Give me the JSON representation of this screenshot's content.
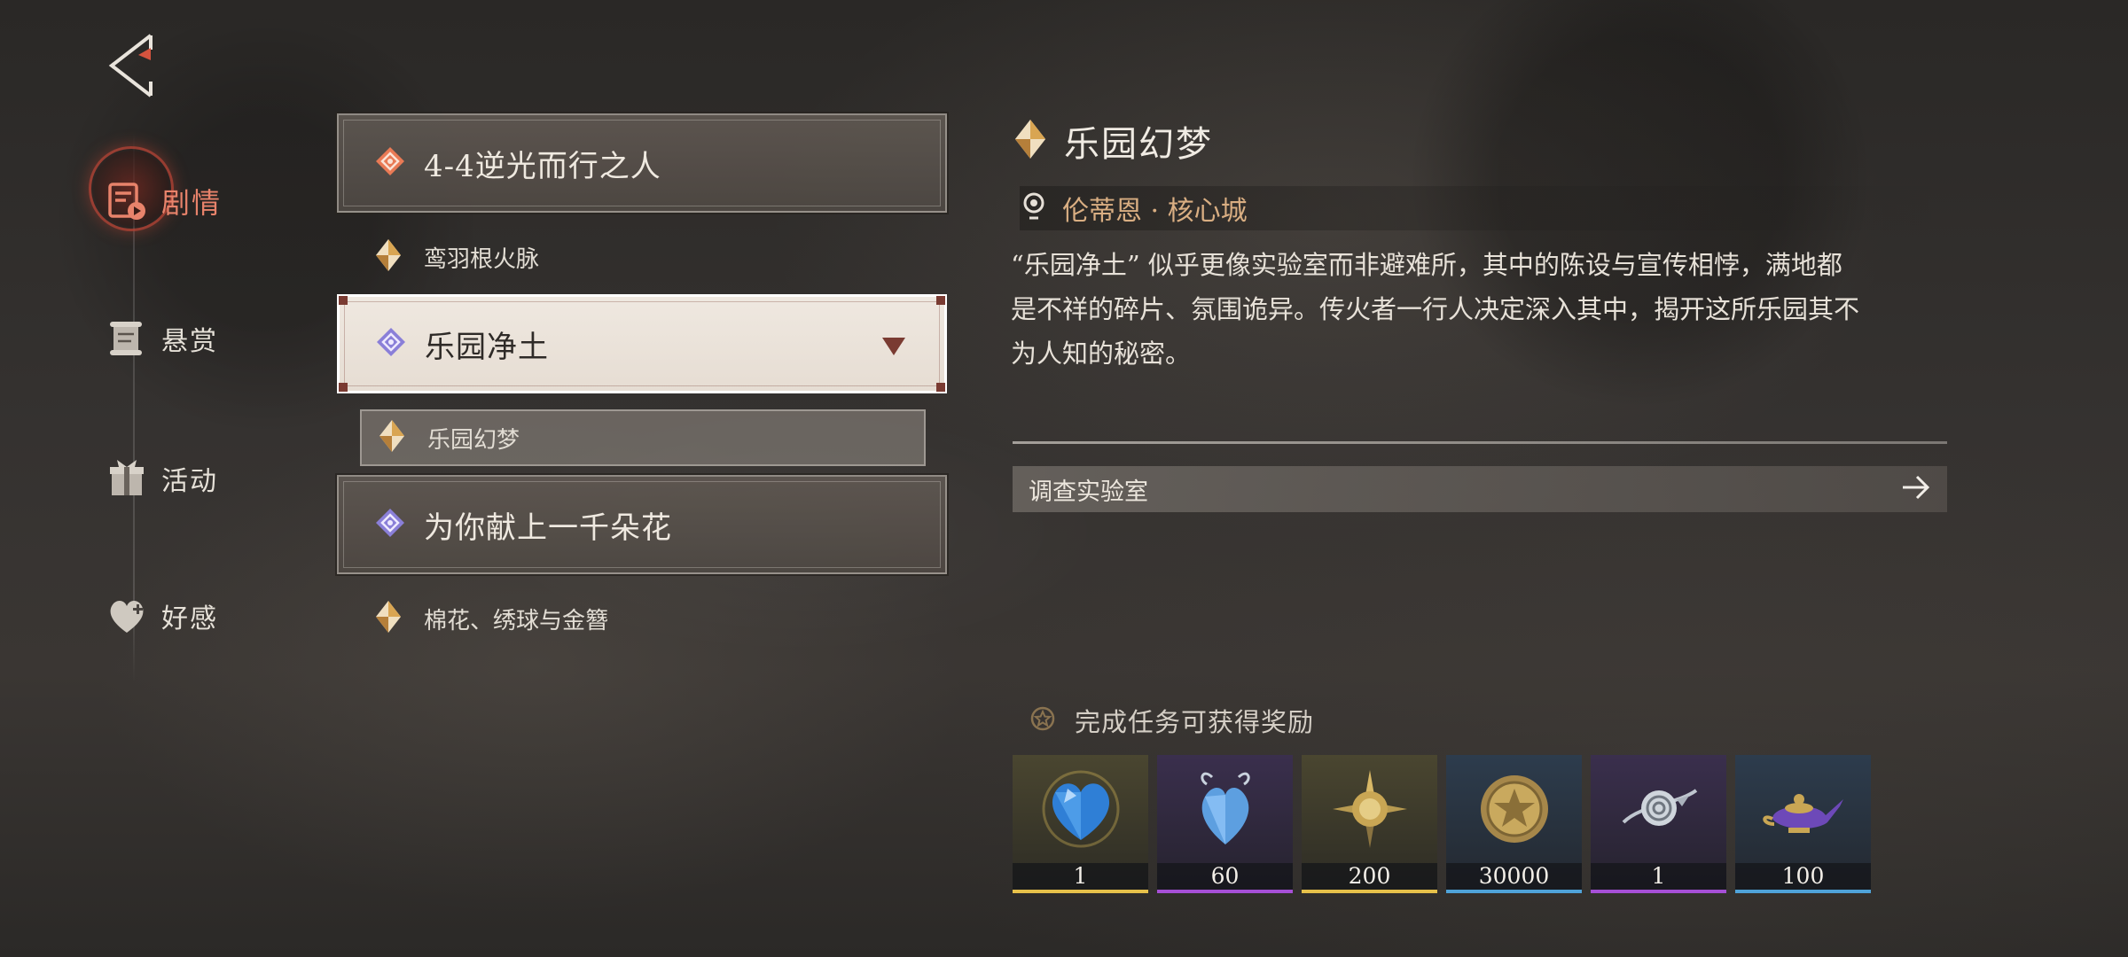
{
  "nav": {
    "items": [
      {
        "label": "剧情",
        "icon": "story-icon",
        "active": true
      },
      {
        "label": "悬赏",
        "icon": "scroll-icon",
        "active": false
      },
      {
        "label": "活动",
        "icon": "gift-icon",
        "active": false
      },
      {
        "label": "好感",
        "icon": "heart-icon",
        "active": false
      }
    ]
  },
  "chapters": [
    {
      "title": "4-4逆光而行之人",
      "selected": false,
      "sub": [
        {
          "text": "鸾羽根火脉",
          "current": false
        }
      ]
    },
    {
      "title": "乐园净土",
      "selected": true,
      "sub": [
        {
          "text": "乐园幻梦",
          "current": true
        }
      ]
    },
    {
      "title": "为你献上一千朵花",
      "selected": false,
      "sub": [
        {
          "text": "棉花、绣球与金簪",
          "current": false
        }
      ]
    }
  ],
  "detail": {
    "title": "乐园幻梦",
    "location": "伦蒂恩 · 核心城",
    "description_lines": [
      "“乐园净土” 似乎更像实验室而非避难所，其中的陈设与宣传相悖，满地都",
      "是不祥的碎片、氛围诡异。传火者一行人决定深入其中，揭开这所乐园其不",
      "为人知的秘密。"
    ],
    "task": "调查实验室"
  },
  "rewards": {
    "title": "完成任务可获得奖励",
    "items": [
      {
        "name": "blue-heart-gem-icon",
        "count": "1",
        "rarity": "gold",
        "rarity_color": "#e7c14a"
      },
      {
        "name": "crystal-heart-icon",
        "count": "60",
        "rarity": "purple",
        "rarity_color": "#a64fd6"
      },
      {
        "name": "gold-sun-emblem-icon",
        "count": "200",
        "rarity": "gold",
        "rarity_color": "#e7c14a"
      },
      {
        "name": "gold-coin-icon",
        "count": "30000",
        "rarity": "blue",
        "rarity_color": "#4fa3d9"
      },
      {
        "name": "silver-rose-icon",
        "count": "1",
        "rarity": "purple",
        "rarity_color": "#a64fd6"
      },
      {
        "name": "magic-lamp-icon",
        "count": "100",
        "rarity": "blue",
        "rarity_color": "#4fa3d9"
      }
    ]
  },
  "colors": {
    "accent_red": "#e8836b",
    "location_gold": "#d9ae82",
    "chapter_marker_red": "#7a3b32"
  }
}
